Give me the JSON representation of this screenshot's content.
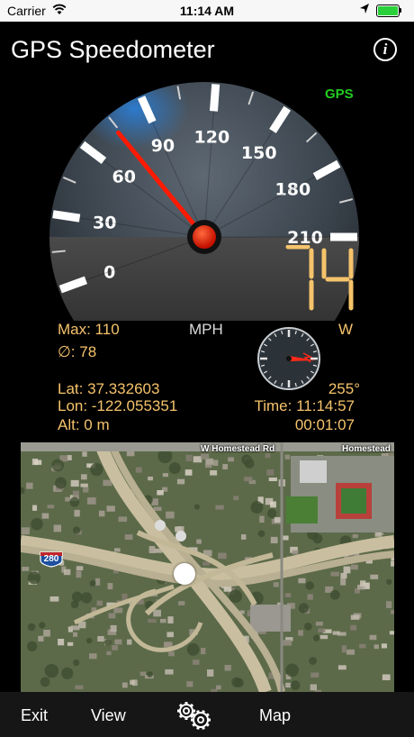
{
  "status_bar": {
    "carrier": "Carrier",
    "time": "11:14 AM",
    "battery_level": 1.0,
    "battery_color": "#2bd13a"
  },
  "header": {
    "title": "GPS Speedometer",
    "info_icon": "info-icon"
  },
  "gauge": {
    "tick_labels": [
      "0",
      "30",
      "60",
      "90",
      "120",
      "150",
      "180",
      "210"
    ],
    "needle_value": 74,
    "max_value": 210,
    "needle_color": "#ff1a00",
    "gps_label": "GPS",
    "gps_color": "#22cc22"
  },
  "readout": {
    "speed": "74",
    "unit": "MPH",
    "max": "Max: 110",
    "avg": "∅: 78",
    "heading_dir": "W",
    "heading_deg": "255°",
    "lat": "Lat: 37.332603",
    "lon": "Lon: -122.055351",
    "alt": "Alt: 0 m",
    "time": "Time: 11:14:57",
    "elapsed": "00:01:07",
    "accent_color": "#f5c36b"
  },
  "map": {
    "road_label_1": "W Homestead Rd",
    "road_label_2": "Homestead",
    "shield": "280"
  },
  "toolbar": {
    "exit": "Exit",
    "view": "View",
    "settings_icon": "gears-icon",
    "map": "Map"
  }
}
